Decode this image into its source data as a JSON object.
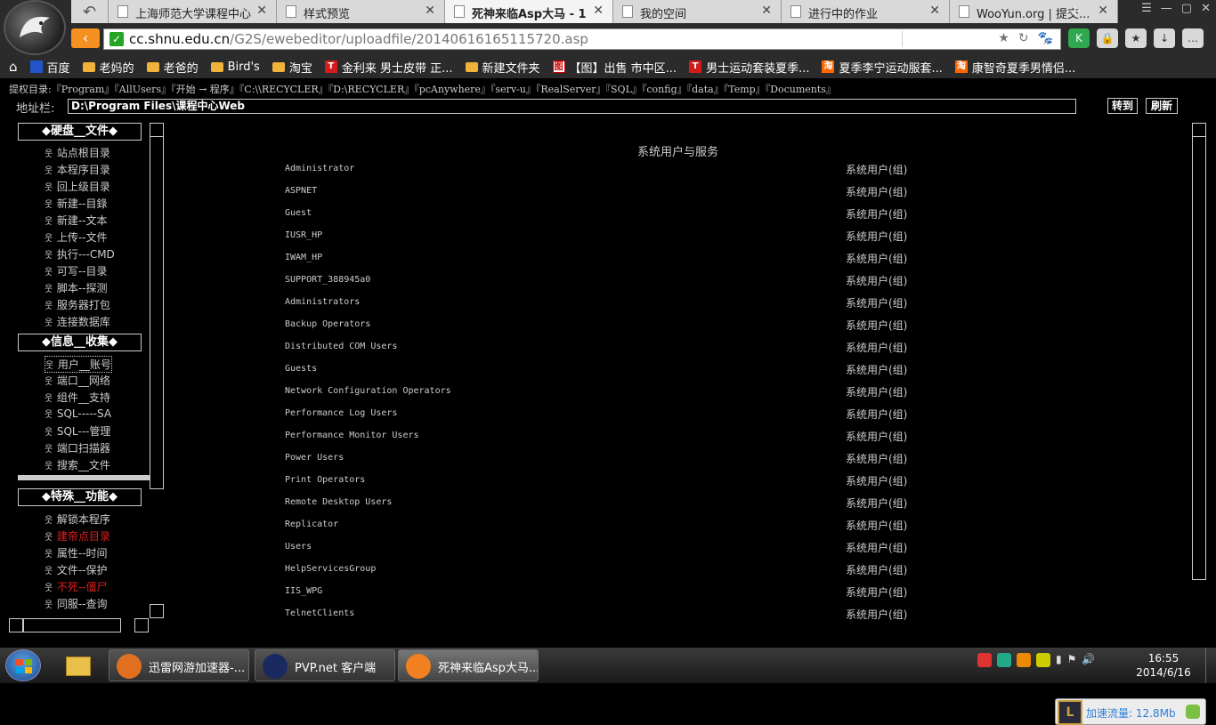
{
  "browser": {
    "tabs": [
      {
        "title": "上海师范大学课程中心",
        "active": false
      },
      {
        "title": "样式预览",
        "active": false
      },
      {
        "title": "死神来临Asp大马 - 1",
        "active": true
      },
      {
        "title": "我的空间",
        "active": false
      },
      {
        "title": "进行中的作业",
        "active": false
      },
      {
        "title": "WooYun.org | 提交...",
        "active": false
      }
    ],
    "url_host": "cc.shnu.edu.cn",
    "url_path": "/G2S/ewebeditor/uploadfile/20140616165115720.asp",
    "bookmarks": [
      {
        "label": "百度",
        "icon": "baidu-icon"
      },
      {
        "label": "老妈的",
        "icon": "folder-icon"
      },
      {
        "label": "老爸的",
        "icon": "folder-icon"
      },
      {
        "label": "Bird's",
        "icon": "folder-icon"
      },
      {
        "label": "淘宝",
        "icon": "folder-icon"
      },
      {
        "label": "金利来 男士皮带 正...",
        "icon": "tmall-icon"
      },
      {
        "label": "新建文件夹",
        "icon": "folder-icon"
      },
      {
        "label": "【图】出售 市中区...",
        "icon": "image-icon"
      },
      {
        "label": "男士运动套装夏季...",
        "icon": "tmall-icon"
      },
      {
        "label": "夏季李宁运动服套...",
        "icon": "taobao-icon"
      },
      {
        "label": "康智奇夏季男情侣...",
        "icon": "taobao-icon"
      }
    ]
  },
  "webshell": {
    "perm_dirs": "提权目录:『Program』『AllUsers』『开始 → 程序』『C:\\\\RECYCLER』『D:\\RECYCLER』『pcAnywhere』『serv-u』『RealServer』『SQL』『config』『data』『Temp』『Documents』",
    "address_label": "地址栏:",
    "address_value": "D:\\Program Files\\课程中心Web",
    "go_label": "转到",
    "refresh_label": "刷新",
    "sections": [
      {
        "title": "◆硬盘__文件◆",
        "items": [
          {
            "label": "站点根目录"
          },
          {
            "label": "本程序目录"
          },
          {
            "label": "回上级目录"
          },
          {
            "label": "新建--目錄"
          },
          {
            "label": "新建--文本"
          },
          {
            "label": "上传--文件"
          },
          {
            "label": "执行---CMD"
          },
          {
            "label": "可写--目录"
          },
          {
            "label": "脚本--探测"
          },
          {
            "label": "服务器打包"
          },
          {
            "label": "连接数据库"
          }
        ]
      },
      {
        "title": "◆信息__收集◆",
        "items": [
          {
            "label": "用户__账号"
          },
          {
            "label": "端口__网络"
          },
          {
            "label": "组件__支持"
          },
          {
            "label": "SQL-----SA"
          },
          {
            "label": "SQL---管理"
          },
          {
            "label": "端口扫描器"
          },
          {
            "label": "搜索__文件"
          }
        ]
      },
      {
        "title": "◆特殊__功能◆",
        "items": [
          {
            "label": "解锁本程序"
          },
          {
            "label": "建帝点目录"
          },
          {
            "label": "属性--时间"
          },
          {
            "label": "文件--保护"
          },
          {
            "label": "不死--僵尸"
          },
          {
            "label": "同服--查询"
          }
        ]
      }
    ],
    "main_title": "系统用户与服务",
    "users": [
      {
        "name": "Administrator",
        "type": "系统用户(组)"
      },
      {
        "name": "ASPNET",
        "type": "系统用户(组)"
      },
      {
        "name": "Guest",
        "type": "系统用户(组)"
      },
      {
        "name": "IUSR_HP",
        "type": "系统用户(组)"
      },
      {
        "name": "IWAM_HP",
        "type": "系统用户(组)"
      },
      {
        "name": "SUPPORT_388945a0",
        "type": "系统用户(组)"
      },
      {
        "name": "Administrators",
        "type": "系统用户(组)"
      },
      {
        "name": "Backup Operators",
        "type": "系统用户(组)"
      },
      {
        "name": "Distributed COM Users",
        "type": "系统用户(组)"
      },
      {
        "name": "Guests",
        "type": "系统用户(组)"
      },
      {
        "name": "Network Configuration Operators",
        "type": "系统用户(组)"
      },
      {
        "name": "Performance Log Users",
        "type": "系统用户(组)"
      },
      {
        "name": "Performance Monitor Users",
        "type": "系统用户(组)"
      },
      {
        "name": "Power Users",
        "type": "系统用户(组)"
      },
      {
        "name": "Print Operators",
        "type": "系统用户(组)"
      },
      {
        "name": "Remote Desktop Users",
        "type": "系统用户(组)"
      },
      {
        "name": "Replicator",
        "type": "系统用户(组)"
      },
      {
        "name": "Users",
        "type": "系统用户(组)"
      },
      {
        "name": "HelpServicesGroup",
        "type": "系统用户(组)"
      },
      {
        "name": "IIS_WPG",
        "type": "系统用户(组)"
      },
      {
        "name": "TelnetClients",
        "type": "系统用户(组)"
      }
    ]
  },
  "flow_widget": {
    "label": "加速流量:",
    "value": "12.8Mb"
  },
  "taskbar": {
    "items": [
      {
        "label": "迅雷网游加速器-...",
        "active": false
      },
      {
        "label": "PVP.net 客户端",
        "active": false
      },
      {
        "label": "死神来临Asp大马...",
        "active": true
      }
    ],
    "time": "16:55",
    "date": "2014/6/16"
  },
  "colors": {
    "accent": "#f59120",
    "red_item": "#e02020",
    "page_bg": "#000000"
  }
}
